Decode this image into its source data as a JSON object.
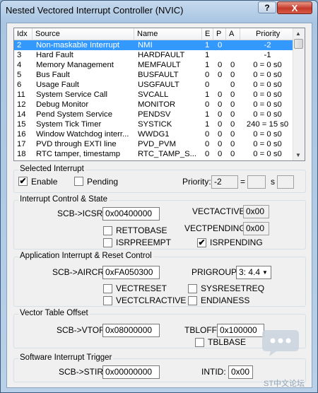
{
  "window": {
    "title": "Nested Vectored Interrupt Controller (NVIC)",
    "help_label": "?",
    "close_label": "X"
  },
  "table": {
    "headers": [
      "Idx",
      "Source",
      "Name",
      "E",
      "P",
      "A",
      "Priority"
    ],
    "rows": [
      [
        "2",
        "Non-maskable Interrupt",
        "NMI",
        "1",
        "0",
        "",
        "-2"
      ],
      [
        "3",
        "Hard Fault",
        "HARDFAULT",
        "1",
        "",
        "",
        "-1"
      ],
      [
        "4",
        "Memory Management",
        "MEMFAULT",
        "1",
        "0",
        "0",
        "0 = 0 s0"
      ],
      [
        "5",
        "Bus Fault",
        "BUSFAULT",
        "0",
        "0",
        "0",
        "0 = 0 s0"
      ],
      [
        "6",
        "Usage Fault",
        "USGFAULT",
        "0",
        "",
        "0",
        "0 = 0 s0"
      ],
      [
        "11",
        "System Service Call",
        "SVCALL",
        "1",
        "0",
        "0",
        "0 = 0 s0"
      ],
      [
        "12",
        "Debug Monitor",
        "MONITOR",
        "0",
        "0",
        "0",
        "0 = 0 s0"
      ],
      [
        "14",
        "Pend System Service",
        "PENDSV",
        "1",
        "0",
        "0",
        "0 = 0 s0"
      ],
      [
        "15",
        "System Tick Timer",
        "SYSTICK",
        "1",
        "0",
        "0",
        "240 = 15 s0"
      ],
      [
        "16",
        "Window Watchdog interr...",
        "WWDG1",
        "0",
        "0",
        "0",
        "0 = 0 s0"
      ],
      [
        "17",
        "PVD through EXTI line",
        "PVD_PVM",
        "0",
        "0",
        "0",
        "0 = 0 s0"
      ],
      [
        "18",
        "RTC tamper, timestamp",
        "RTC_TAMP_S...",
        "0",
        "0",
        "0",
        "0 = 0 s0"
      ]
    ],
    "selected_index": 0
  },
  "selected_interrupt": {
    "title": "Selected Interrupt",
    "enable_label": "Enable",
    "enable_checked": "✔",
    "pending_label": "Pending",
    "priority_label": "Priority:",
    "priority_value": "-2",
    "equals": "=",
    "s_label": "s",
    "group_value": "",
    "sub_value": ""
  },
  "icsr": {
    "title": "Interrupt Control & State",
    "label": "SCB->ICSR:",
    "value": "0x00400000",
    "vectactive_label": "VECTACTIVE:",
    "vectactive_value": "0x00",
    "vectpending_label": "VECTPENDING:",
    "vectpending_value": "0x00",
    "rettobase_label": "RETTOBASE",
    "isrpreempt_label": "ISRPREEMPT",
    "isrpending_label": "ISRPENDING",
    "isrpending_checked": "✔"
  },
  "aircr": {
    "title": "Application Interrupt & Reset Control",
    "label": "SCB->AIRCR:",
    "value": "0xFA050300",
    "prigroup_label": "PRIGROUP:",
    "prigroup_value": "3: 4.4",
    "vectreset_label": "VECTRESET",
    "sysresetreq_label": "SYSRESETREQ",
    "vectclractive_label": "VECTCLRACTIVE",
    "endianess_label": "ENDIANESS"
  },
  "vtor": {
    "title": "Vector Table Offset",
    "label": "SCB->VTOR:",
    "value": "0x08000000",
    "tbloff_label": "TBLOFF:",
    "tbloff_value": "0x100000",
    "tblbase_label": "TBLBASE"
  },
  "stir": {
    "title": "Software Interrupt Trigger",
    "label": "SCB->STIR:",
    "value": "0x00000000",
    "intid_label": "INTID:",
    "intid_value": "0x00"
  },
  "watermark": "ST中文论坛",
  "colors": {
    "selection": "#3399ff",
    "close_button": "#c4392a"
  }
}
